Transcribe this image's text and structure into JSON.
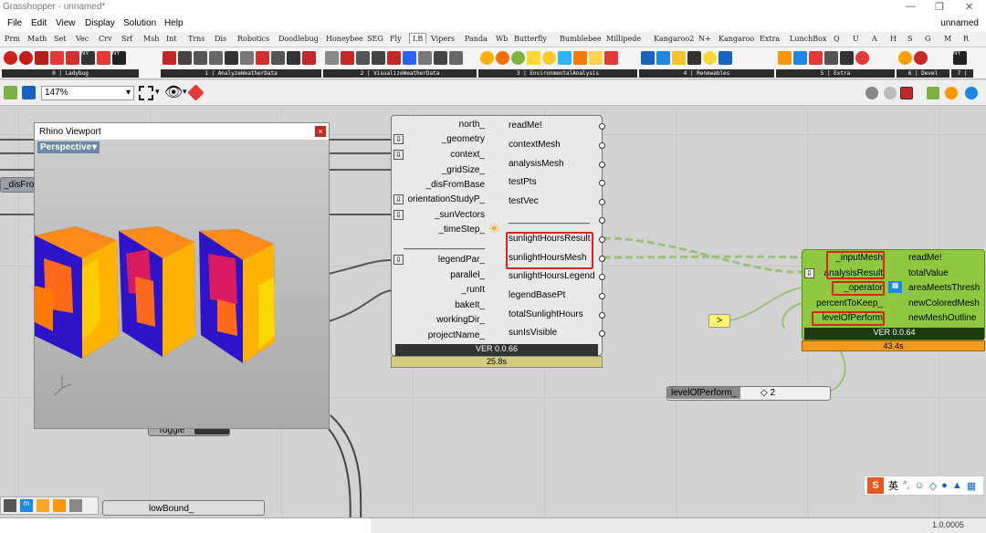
{
  "app": {
    "title": "Grasshopper - unnamed*",
    "doc_name": "unnamed"
  },
  "menu": [
    "File",
    "Edit",
    "View",
    "Display",
    "Solution",
    "Help"
  ],
  "tabs": [
    "Prm",
    "Math",
    "Set",
    "Vec",
    "Crv",
    "Srf",
    "Msh",
    "Int",
    "Trns",
    "Dis",
    "Robotics",
    "Doodlebug",
    "Honeybee",
    "SEG",
    "Fly",
    "LB",
    "Vipers",
    "Panda",
    "Wb",
    "Butterfly",
    "Bumblebee",
    "Millipede",
    "Kangaroo2",
    "N+",
    "Kangaroo",
    "Extra",
    "LunchBox",
    "Q",
    "U",
    "A",
    "H",
    "S",
    "G",
    "M",
    "R"
  ],
  "active_tab": "LB",
  "ribbon_groups": [
    "0 | Ladybug",
    "1 | AnalyzeWeatherData",
    "2 | VisualizeWeatherData",
    "3 | EnvironmentalAnalysis",
    "4 | Renewables",
    "5 | Extra",
    "6 | Devel",
    "7 | "
  ],
  "toolbar": {
    "zoom": "147%"
  },
  "viewport": {
    "title": "Rhino Viewport",
    "view": "Perspective",
    "close": "×"
  },
  "left_params": {
    "disfrom": "_disFrom",
    "toggle": "Toggle",
    "lowbound": "lowBound_"
  },
  "sunlight_comp": {
    "inputs": [
      "north_",
      "_geometry",
      "context_",
      "_gridSize_",
      "_disFromBase",
      "orientationStudyP_",
      "_sunVectors",
      "_timeStep_",
      "________________",
      "legendPar_",
      "parallel_",
      "_runIt",
      "bakeIt_",
      "workingDir_",
      "projectName_"
    ],
    "outputs": [
      "readMe!",
      "contextMesh",
      "analysisMesh",
      "testPts",
      "testVec",
      "________________",
      "sunlightHoursResult",
      "sunlightHoursMesh",
      "sunlightHoursLegend",
      "legendBasePt",
      "totalSunlightHours",
      "sunIsVisible"
    ],
    "version": "VER 0.0.66",
    "time": "25.8s"
  },
  "thresh_comp": {
    "inputs": [
      "_inputMesh",
      "analysisResult",
      "_operator",
      "percentToKeep_",
      "levelOfPerform"
    ],
    "outputs": [
      "readMe!",
      "totalValue",
      "areaMeetsThresh",
      "newColoredMesh",
      "newMeshOutline"
    ],
    "version": "VER 0.0.64",
    "time": "43.4s"
  },
  "operator_panel": {
    "value": ">"
  },
  "level_slider": {
    "label": "levelOfPerform_",
    "value": "◇ 2"
  },
  "status": {
    "version": "1.0.0005"
  },
  "ime": {
    "lang": "英"
  },
  "colors": {
    "accent_green": "#8fc73e",
    "time_gold": "#d2c77a",
    "time_orange": "#f39a1e",
    "highlight_red": "#d9231f"
  }
}
